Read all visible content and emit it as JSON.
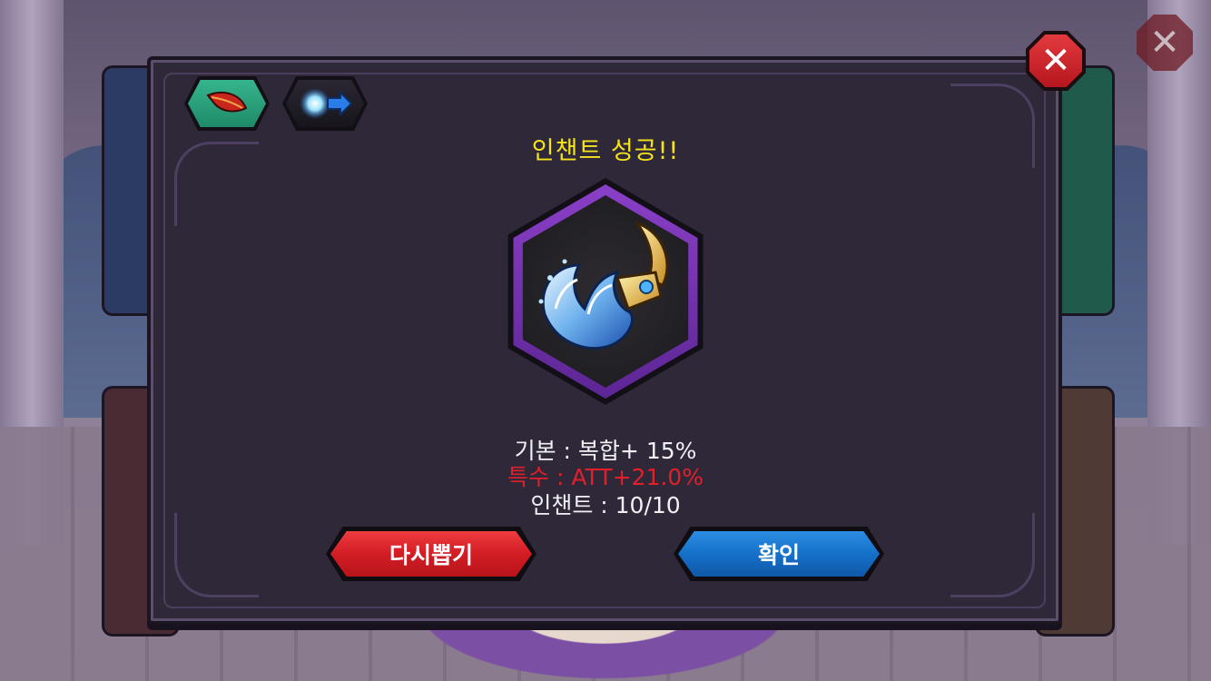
{
  "dialog": {
    "title": "인챈트 성공!!",
    "stats": {
      "base": "기본 : 복합+ 15%",
      "special": "특수 : ATT+21.0%",
      "enchant": "인챈트 : 10/10"
    },
    "buttons": {
      "redraw": "다시뽑기",
      "confirm": "확인"
    },
    "tabs": [
      {
        "icon": "red-feather-icon"
      },
      {
        "icon": "energy-burst-arrow-icon"
      }
    ],
    "item_icon": "water-wave-claw-icon",
    "close_icon": "close-icon"
  },
  "colors": {
    "title": "#f5e31c",
    "special_stat": "#e0202b",
    "redraw_button": "#d21d24",
    "confirm_button": "#1670c9",
    "item_ring": "#7a34b3",
    "dialog_bg": "#2e2839"
  }
}
